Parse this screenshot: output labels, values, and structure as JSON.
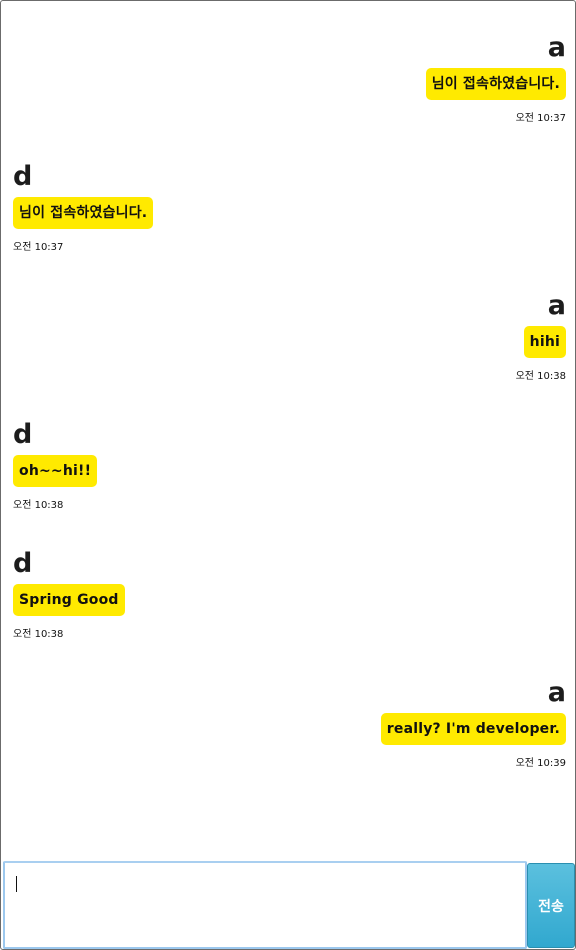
{
  "messages": [
    {
      "sender": "a",
      "side": "right",
      "text": "님이 접속하였습니다.",
      "time": "오전 10:37"
    },
    {
      "sender": "d",
      "side": "left",
      "text": "님이 접속하였습니다.",
      "time": "오전 10:37"
    },
    {
      "sender": "a",
      "side": "right",
      "text": "hihi",
      "time": "오전 10:38"
    },
    {
      "sender": "d",
      "side": "left",
      "text": "oh~~hi!!",
      "time": "오전 10:38"
    },
    {
      "sender": "d",
      "side": "left",
      "text": "Spring Good",
      "time": "오전 10:38"
    },
    {
      "sender": "a",
      "side": "right",
      "text": "really? I'm developer.",
      "time": "오전 10:39"
    }
  ],
  "composer": {
    "input_value": "",
    "send_label": "전송"
  },
  "colors": {
    "bubble": "#ffea00",
    "send_button": "#31a8cf",
    "input_border": "#9cc8ee"
  }
}
